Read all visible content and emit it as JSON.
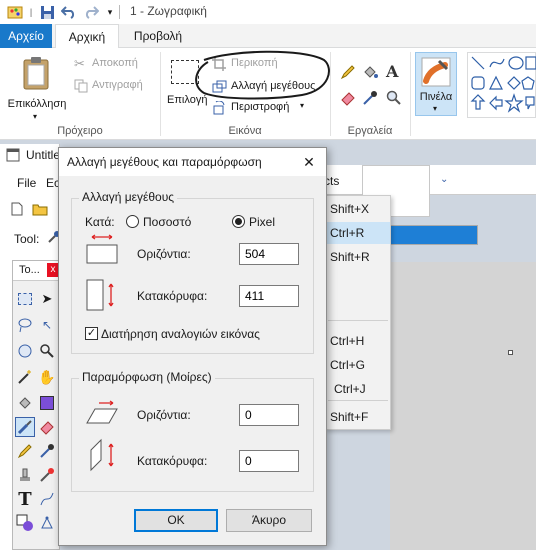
{
  "app": {
    "title": "1 - Ζωγραφική"
  },
  "ribbon": {
    "tabs": [
      "Αρχείο",
      "Αρχική",
      "Προβολή"
    ],
    "clipboard": {
      "paste": "Επικόλληση",
      "cut": "Αποκοπή",
      "copy": "Αντιγραφή",
      "group": "Πρόχειρο"
    },
    "image": {
      "select": "Επιλογή",
      "crop": "Περικοπή",
      "resize": "Αλλαγή μεγέθους",
      "rotate": "Περιστροφή",
      "group": "Εικόνα"
    },
    "tools": {
      "group": "Εργαλεία"
    },
    "brushes": {
      "label": "Πινέλα"
    }
  },
  "window2": {
    "title": "Untitle",
    "menu_file": "File",
    "menu_edit": "Ec",
    "toolbar_label": "Tool:",
    "toolbox_title": "To...",
    "toolbox_close": "x",
    "partial_tab": "cts"
  },
  "dialog": {
    "title": "Αλλαγή μεγέθους και παραμόρφωση",
    "close": "✕",
    "resize_group": "Αλλαγή μεγέθους",
    "by_label": "Κατά:",
    "percent_option": "Ποσοστό",
    "pixel_option": "Pixel",
    "horizontal_label": "Οριζόντια:",
    "vertical_label": "Κατακόρυφα:",
    "resize_horizontal_value": "504",
    "resize_vertical_value": "411",
    "keep_aspect_label": "Διατήρηση αναλογιών εικόνας",
    "skew_group": "Παραμόρφωση (Μοίρες)",
    "skew_horizontal_value": "0",
    "skew_vertical_value": "0",
    "ok": "OK",
    "cancel": "Άκυρο"
  },
  "context_menu": {
    "items": [
      "Shift+X",
      "Ctrl+R",
      "Shift+R",
      "Ctrl+H",
      "Ctrl+G",
      "Ctrl+J",
      "Shift+F"
    ]
  },
  "colors": {
    "accent": "#1979ca",
    "highlight": "#cce4f7",
    "workspace": "#ced6e0"
  }
}
